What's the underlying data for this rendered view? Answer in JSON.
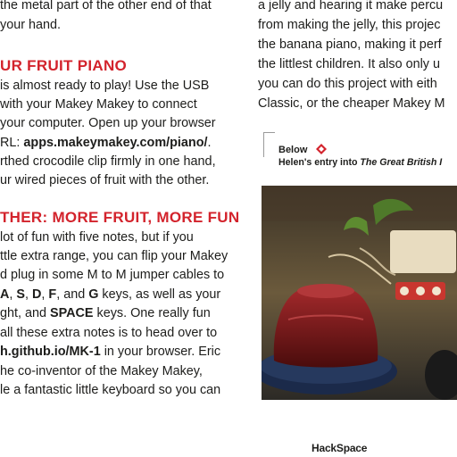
{
  "left_column": {
    "line1": "the metal part of the other end of that",
    "line2": "your hand.",
    "heading1": "UR FRUIT PIANO",
    "p1_line1": "is almost ready to play! Use the USB",
    "p1_line2": "with your Makey Makey to connect",
    "p1_line3": "your computer. Open up your browser",
    "p1_line4_prefix": "RL: ",
    "p1_line4_url": "apps.makeymakey.com/piano/",
    "p1_line4_suffix": ".",
    "p1_line5": "rthed crocodile clip firmly in one hand,",
    "p1_line6": "ur wired pieces of fruit with the other.",
    "heading2": "THER: MORE FRUIT, MORE FUN",
    "p2_line1": "lot of fun with five notes, but if you",
    "p2_line2": "ttle extra range, you can flip your Makey",
    "p2_line3": "d plug in some M to M jumper cables to",
    "p2_line4": {
      "k1": "A",
      "s1": ", ",
      "k2": "S",
      "s2": ", ",
      "k3": "D",
      "s3": ", ",
      "k4": "F",
      "s4": ", and ",
      "k5": "G",
      "s5": " keys, as well as your"
    },
    "p2_line5": {
      "pre": "ght, and ",
      "key": "SPACE",
      "post": " keys. One really fun"
    },
    "p2_line6": "all these extra notes is to head over to",
    "p2_line7": {
      "url": "h.github.io/MK-1",
      "post": " in your browser. Eric"
    },
    "p2_line8": "he co-inventor of the Makey Makey,",
    "p2_line9": "le a fantastic little keyboard so you can"
  },
  "right_column": {
    "line1": "a jelly and hearing it make percu",
    "line2": "from making the jelly, this projec",
    "line3": "the banana piano, making it perf",
    "line4": "the littlest children. It also only u",
    "line5": "you can do this project with eith",
    "line6": "Classic, or the cheaper Makey M",
    "caption": {
      "label": "Below",
      "text_prefix": "Helen's entry into ",
      "text_title": "The Great British I"
    }
  },
  "footer": {
    "logo": "HackSpace"
  },
  "colors": {
    "text": "#1d1d1b",
    "heading": "#d3232c",
    "jelly": "#6e1414",
    "plate": "#1b2a4a"
  }
}
